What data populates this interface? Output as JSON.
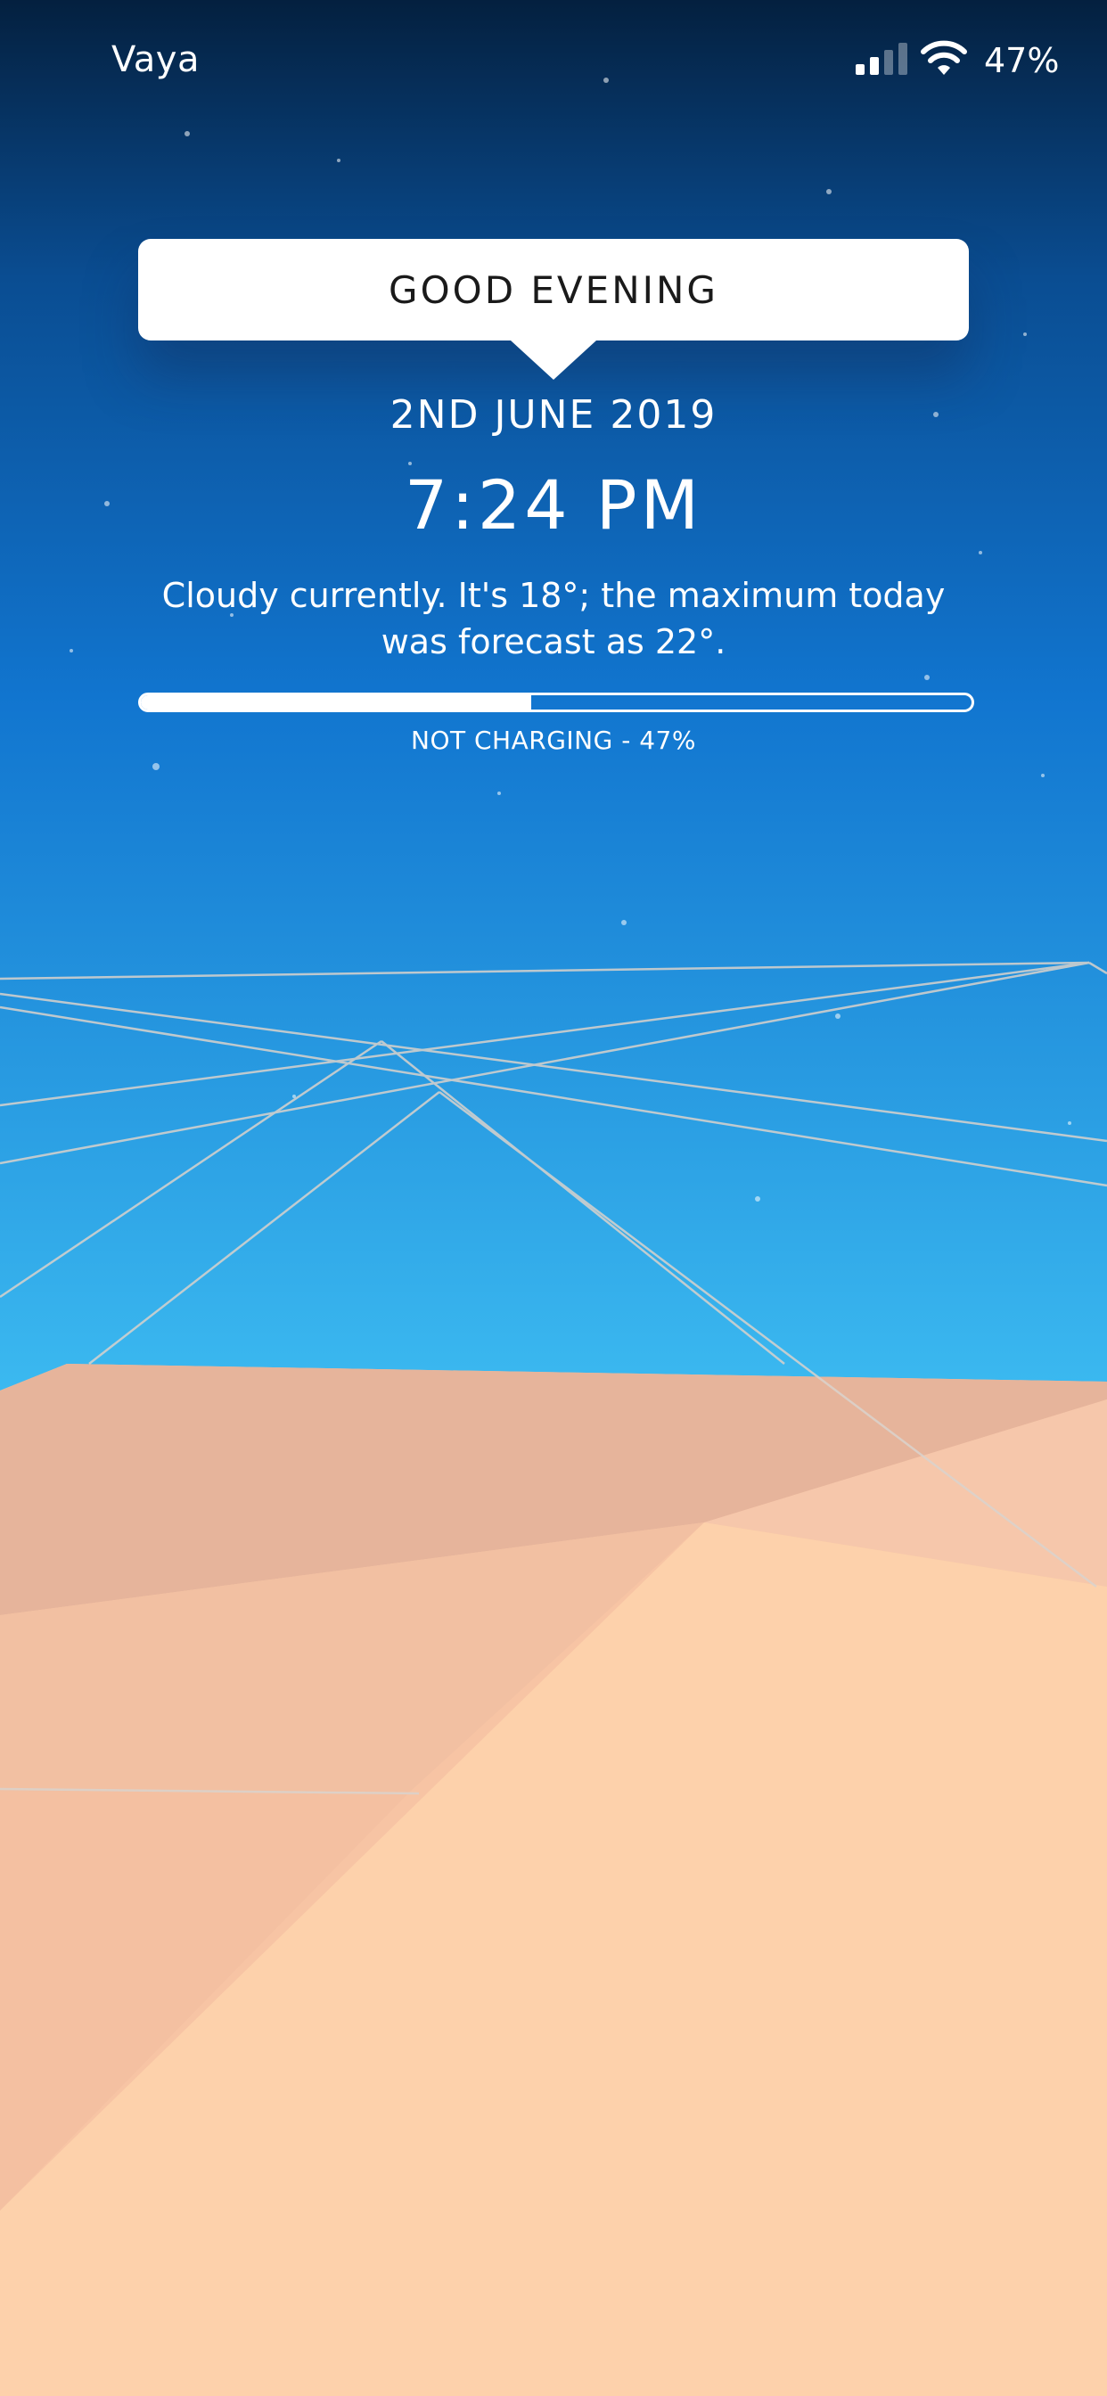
{
  "status_bar": {
    "carrier": "Vaya",
    "signal_icon": "cellular-signal-icon",
    "wifi_icon": "wifi-icon",
    "battery_percent_label": "47%"
  },
  "greeting": {
    "text": "GOOD EVENING"
  },
  "date": "2ND JUNE 2019",
  "time": "7:24 PM",
  "weather": {
    "summary": "Cloudy currently. It's 18°; the maximum today was forecast as 22°."
  },
  "battery": {
    "level_fraction": 0.47,
    "status_label": "NOT CHARGING - 47%"
  },
  "colors": {
    "sky_top": "#062347",
    "sky_mid": "#0f6cc9",
    "sky_bottom": "#39b5ef",
    "sand": "#fdd1ab",
    "text": "#ffffff"
  }
}
